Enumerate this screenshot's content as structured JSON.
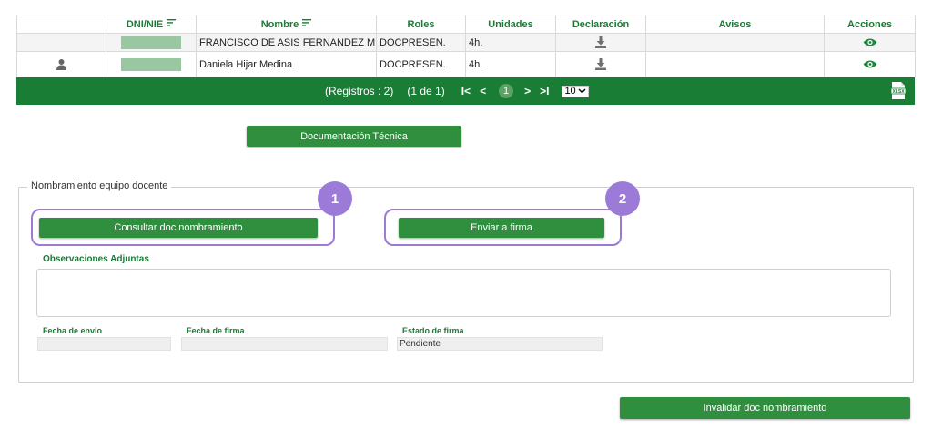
{
  "table": {
    "headers": [
      "",
      "DNI/NIE",
      "Nombre",
      "Roles",
      "Unidades",
      "Declaración",
      "Avisos",
      "Acciones"
    ],
    "rows": [
      {
        "nombre": "FRANCISCO DE ASIS FERNANDEZ MISER",
        "roles": "DOCPRESEN.",
        "unidades": "4h."
      },
      {
        "nombre": "Daniela Hijar Medina",
        "roles": "DOCPRESEN.",
        "unidades": "4h."
      }
    ]
  },
  "pager": {
    "registros": "(Registros : 2)",
    "pagina": "(1 de 1)",
    "first": "I<",
    "prev": "<",
    "current": "1",
    "next": ">",
    "last": ">I",
    "rows_per_page": "10"
  },
  "buttons": {
    "documentacion": "Documentación Técnica",
    "consultar": "Consultar doc nombramiento",
    "enviar": "Enviar a firma",
    "invalidar": "Invalidar doc nombramiento"
  },
  "section": {
    "legend": "Nombramiento equipo docente",
    "observaciones_label": "Observaciones Adjuntas",
    "fecha_envio_label": "Fecha de envio",
    "fecha_envio_value": "",
    "fecha_firma_label": "Fecha de firma",
    "fecha_firma_value": "",
    "estado_label": "Estado de firma",
    "estado_value": "Pendiente"
  },
  "annotations": {
    "badge1": "1",
    "badge2": "2"
  },
  "colors": {
    "primary_green": "#1a7d35",
    "button_green": "#2f8f3f",
    "highlight_purple": "#9b7ad8",
    "masked_dni": "#98c7a2"
  },
  "icons": {
    "sort": "sort-icon",
    "download": "download-icon",
    "view": "eye-icon",
    "user": "user-icon",
    "excel": "xlsx-icon",
    "dropdown": "chevron-down-icon"
  }
}
